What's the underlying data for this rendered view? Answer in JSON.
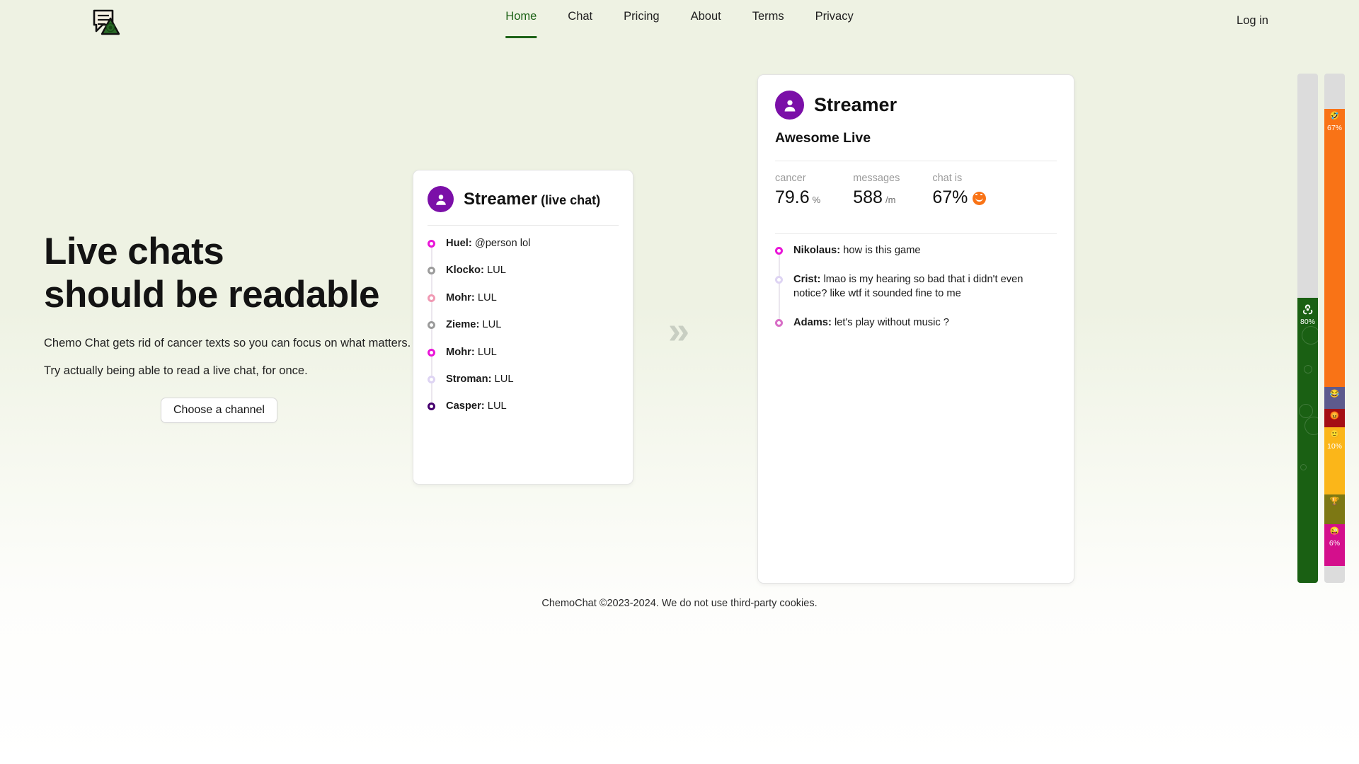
{
  "brand": {
    "logo_icon": "chat-biohazard-logo",
    "name": "ChemoChat"
  },
  "nav": {
    "items": [
      {
        "label": "Home",
        "active": true
      },
      {
        "label": "Chat",
        "active": false
      },
      {
        "label": "Pricing",
        "active": false
      },
      {
        "label": "About",
        "active": false
      },
      {
        "label": "Terms",
        "active": false
      },
      {
        "label": "Privacy",
        "active": false
      }
    ],
    "login_label": "Log in",
    "active_color": "#1d6317"
  },
  "hero": {
    "title_line1": "Live chats",
    "title_line2": "should be readable",
    "paragraph1": "Chemo Chat gets rid of cancer texts so you can focus on what matters.",
    "paragraph2": "Try actually being able to read a live chat, for once.",
    "cta_label": "Choose a channel"
  },
  "arrow": {
    "glyph": "»"
  },
  "left_card": {
    "avatar_icon": "person-avatar-icon",
    "avatar_color": "#7b0fa8",
    "streamer": "Streamer",
    "tag": "(live chat)",
    "messages": [
      {
        "author": "Huel:",
        "text": "@person lol",
        "dot": "#e916d8"
      },
      {
        "author": "Klocko:",
        "text": "LUL",
        "dot": "#9b9b9b"
      },
      {
        "author": "Mohr:",
        "text": "LUL",
        "dot": "#f09ab4"
      },
      {
        "author": "Zieme:",
        "text": "LUL",
        "dot": "#9b9b9b"
      },
      {
        "author": "Mohr:",
        "text": "LUL",
        "dot": "#e916d8"
      },
      {
        "author": "Stroman:",
        "text": "LUL",
        "dot": "#ded4f3"
      },
      {
        "author": "Casper:",
        "text": "LUL",
        "dot": "#45006e"
      }
    ]
  },
  "right_card": {
    "avatar_icon": "person-avatar-icon",
    "avatar_color": "#7b0fa8",
    "streamer": "Streamer",
    "subtitle": "Awesome Live",
    "stats": [
      {
        "label": "cancer",
        "value": "79.6",
        "unit": "%",
        "emoji": ""
      },
      {
        "label": "messages",
        "value": "588",
        "unit": "/m",
        "emoji": ""
      },
      {
        "label": "chat is",
        "value": "67%",
        "unit": "",
        "emoji": "rofl-emoji"
      }
    ],
    "messages": [
      {
        "author": "Nikolaus:",
        "text": "how is this game",
        "dot": "#e916d8"
      },
      {
        "author": "Crist:",
        "text": "lmao is my hearing so bad that i didn't even notice? like wtf it sounded fine to me",
        "dot": "#ded4f3"
      },
      {
        "author": "Adams:",
        "text": "let's play without music ?",
        "dot": "#d86ec6"
      }
    ]
  },
  "gauges": [
    {
      "name": "cancer-gauge",
      "icon": "biohazard-icon",
      "percent_label": "80%",
      "fill_ratio": 0.56,
      "color": "#1a6013"
    },
    {
      "name": "chat-mood-gauge",
      "icon": "rofl-emoji",
      "percent_label": "67%",
      "fill_ratio": 0.93,
      "color": "#f97316",
      "segments": [
        {
          "color": "#f97316",
          "icon": "rofl-emoji",
          "label": "67%",
          "height_ratio": 0.545,
          "icon_glyph": "🤣"
        },
        {
          "color": "#5d5a8d",
          "icon": "joy-emoji",
          "label": "",
          "height_ratio": 0.043,
          "icon_glyph": "😂"
        },
        {
          "color": "#a40f14",
          "icon": "angry-emoji",
          "label": "",
          "height_ratio": 0.036,
          "icon_glyph": "😡"
        },
        {
          "color": "#fbb619",
          "icon": "smile-emoji",
          "label": "10%",
          "height_ratio": 0.133,
          "icon_glyph": "🙂"
        },
        {
          "color": "#7d7814",
          "icon": "trophy-icon",
          "label": "",
          "height_ratio": 0.058,
          "icon_glyph": "🏆"
        },
        {
          "color": "#d40f8c",
          "icon": "tongue-emoji",
          "label": "6%",
          "height_ratio": 0.082,
          "icon_glyph": "😜"
        }
      ]
    }
  ],
  "footer": {
    "text": "ChemoChat ©2023-2024. We do not use third-party cookies."
  }
}
